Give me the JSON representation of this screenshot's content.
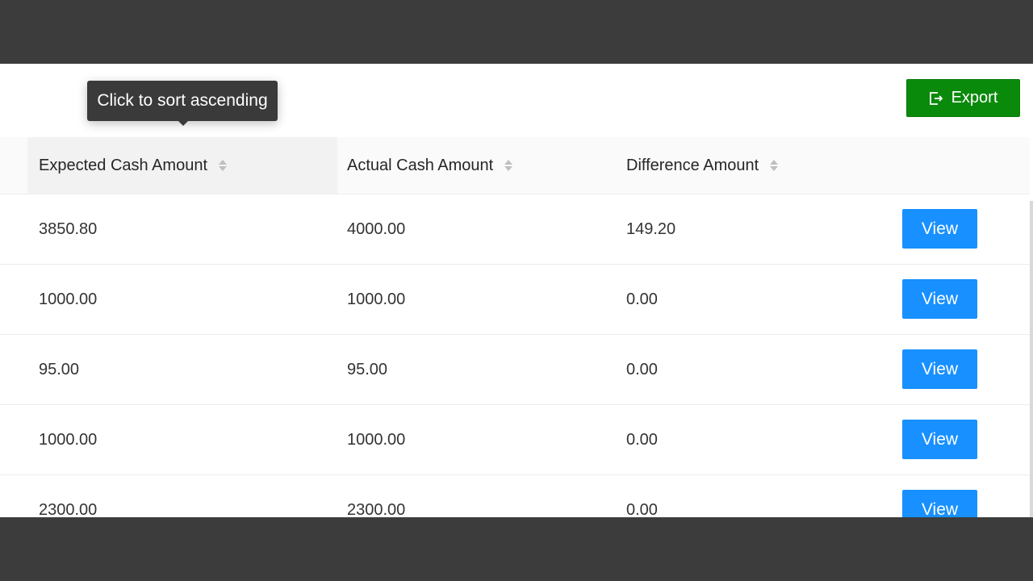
{
  "toolbar": {
    "export_label": "Export",
    "export_icon": "export-icon",
    "export_color": "#0a8a0a"
  },
  "tooltip": {
    "text": "Click to sort ascending"
  },
  "table": {
    "columns": [
      "Expected Cash Amount",
      "Actual Cash Amount",
      "Difference Amount"
    ],
    "sort_icon": "sort-icon",
    "rows": [
      {
        "expected": "3850.80",
        "actual": "4000.00",
        "difference": "149.20",
        "action": "View"
      },
      {
        "expected": "1000.00",
        "actual": "1000.00",
        "difference": "0.00",
        "action": "View"
      },
      {
        "expected": "95.00",
        "actual": "95.00",
        "difference": "0.00",
        "action": "View"
      },
      {
        "expected": "1000.00",
        "actual": "1000.00",
        "difference": "0.00",
        "action": "View"
      },
      {
        "expected": "2300.00",
        "actual": "2300.00",
        "difference": "0.00",
        "action": "View"
      }
    ],
    "action_color": "#1890ff"
  }
}
